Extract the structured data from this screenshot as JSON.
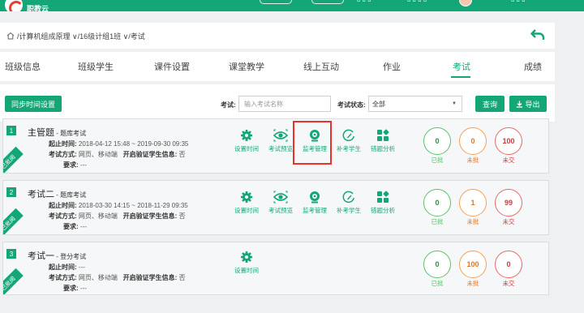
{
  "header": {
    "logo_text": "职教云"
  },
  "breadcrumb": {
    "items": [
      "/计算机组成原理 ∨",
      "/16级计组1班 ∨",
      "/考试"
    ]
  },
  "tabs": [
    "班级信息",
    "班级学生",
    "课件设置",
    "课堂教学",
    "线上互动",
    "作业",
    "考试",
    "成绩"
  ],
  "active_tab": "考试",
  "toolbar": {
    "sync_label": "同步时间设置",
    "exam_label": "考试:",
    "exam_placeholder": "输入考试名称",
    "status_label": "考试状态:",
    "status_value": "全部",
    "search_label": "查询",
    "export_label": "导出"
  },
  "exams": [
    {
      "index": "1",
      "ribbon": "已批阅",
      "title": "主管题",
      "subtitle": " - 题库考试",
      "time_label": "起止时间:",
      "time": "2018-04-12 15:48 ~ 2019-09-30 09:35",
      "method_label": "考试方式:",
      "method": "网页、移动端",
      "verify_label": "开启验证学生信息:",
      "verify": "否",
      "req_label": "要求:",
      "req": "---",
      "actions": [
        "设置时间",
        "考试预览",
        "监考管理",
        "补考学生",
        "错题分析"
      ],
      "stats": [
        {
          "value": "0",
          "label": "已批"
        },
        {
          "value": "0",
          "label": "未批"
        },
        {
          "value": "100",
          "label": "未交"
        }
      ]
    },
    {
      "index": "2",
      "ribbon": "已批阅",
      "title": "考试二",
      "subtitle": " - 题库考试",
      "time_label": "起止时间:",
      "time": "2018-03-30 14:15 ~ 2018-11-29 09:35",
      "method_label": "考试方式:",
      "method": "网页、移动端",
      "verify_label": "开启验证学生信息:",
      "verify": "否",
      "req_label": "要求:",
      "req": "---",
      "actions": [
        "设置时间",
        "考试预览",
        "监考管理",
        "补考学生",
        "错题分析"
      ],
      "stats": [
        {
          "value": "0",
          "label": "已批"
        },
        {
          "value": "1",
          "label": "未批"
        },
        {
          "value": "99",
          "label": "未交"
        }
      ]
    },
    {
      "index": "3",
      "ribbon": "已批阅",
      "title": "考试一",
      "subtitle": " - 登分考试",
      "time_label": "起止时间:",
      "time": "---",
      "method_label": "考试方式:",
      "method": "网页、移动端",
      "verify_label": "开启验证学生信息:",
      "verify": "否",
      "req_label": "要求:",
      "req": "---",
      "actions": [
        "设置时间"
      ],
      "stats": [
        {
          "value": "0",
          "label": "已批"
        },
        {
          "value": "100",
          "label": "未批"
        },
        {
          "value": "0",
          "label": "未交"
        }
      ]
    }
  ],
  "colors": {
    "accent": "#14a677",
    "highlight": "#e8322c",
    "approved": "#5cc06a",
    "pending": "#e0782a",
    "missing": "#cc3b3b"
  }
}
